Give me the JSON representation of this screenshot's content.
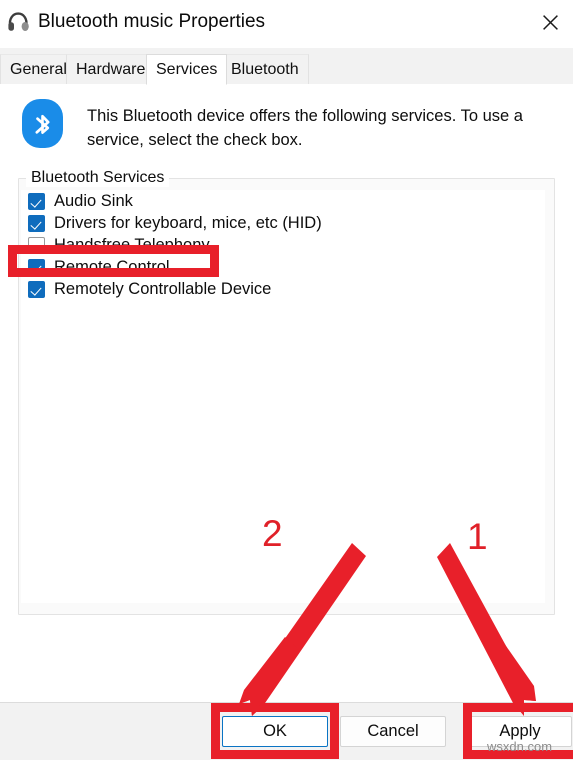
{
  "window": {
    "title": "Bluetooth music Properties",
    "icon": "headphones-icon",
    "close_label": "✕"
  },
  "tabs": [
    {
      "label": "General",
      "active": false
    },
    {
      "label": "Hardware",
      "active": false
    },
    {
      "label": "Services",
      "active": true
    },
    {
      "label": "Bluetooth",
      "active": false
    }
  ],
  "content": {
    "icon": "bluetooth-icon",
    "description": "This Bluetooth device offers the following services. To use a service, select the check box.",
    "group_label": "Bluetooth Services",
    "services": [
      {
        "label": "Audio Sink",
        "checked": true
      },
      {
        "label": "Drivers for keyboard, mice, etc (HID)",
        "checked": true
      },
      {
        "label": "Handsfree Telephony",
        "checked": false
      },
      {
        "label": "Remote Control",
        "checked": true
      },
      {
        "label": "Remotely Controllable Device",
        "checked": true
      }
    ]
  },
  "footer": {
    "ok_label": "OK",
    "cancel_label": "Cancel",
    "apply_label": "Apply"
  },
  "annotations": {
    "color": "#e8202a",
    "step_one": "1",
    "step_two": "2",
    "watermark": "wsxdn.com"
  }
}
